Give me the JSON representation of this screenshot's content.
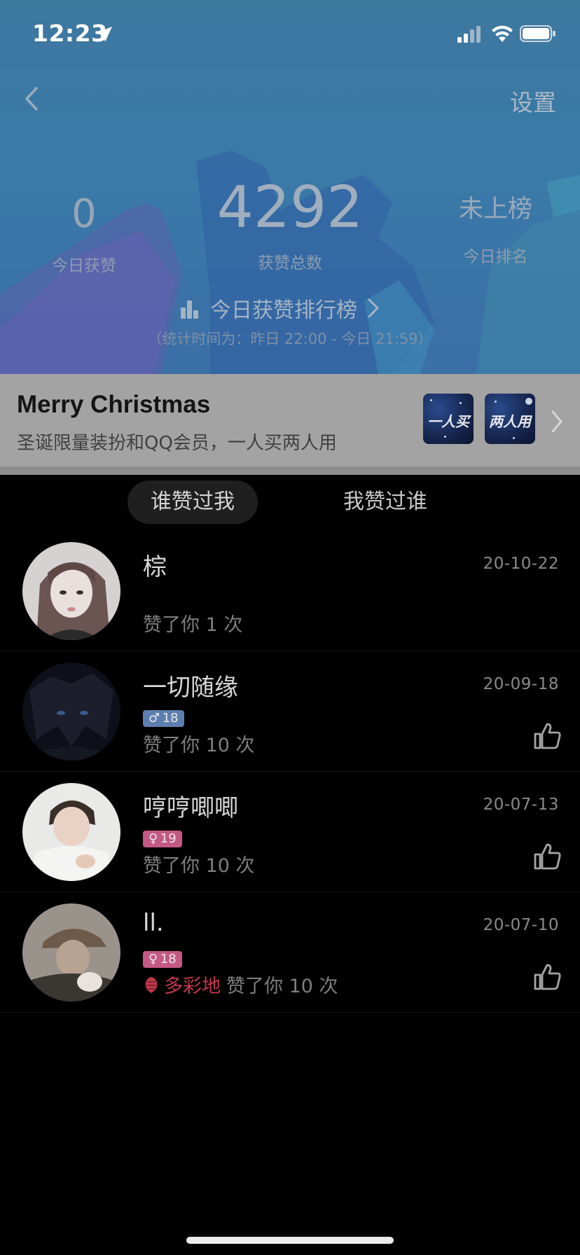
{
  "status": {
    "time": "12:23"
  },
  "header": {
    "settings_label": "设置",
    "stats": {
      "today_value": "0",
      "today_label": "今日获赞",
      "total_value": "4292",
      "total_label": "获赞总数",
      "rank_value": "未上榜",
      "rank_label": "今日排名"
    },
    "ranking_link_label": "今日获赞排行榜",
    "period_text": "（统计时间为：昨日 22:00 - 今日 21:59）"
  },
  "banner": {
    "title": "Merry Christmas",
    "subtitle": "圣诞限量装扮和QQ会员，一人买两人用",
    "thumb_1_label": "一人买",
    "thumb_2_label": "两人用"
  },
  "tabs": [
    {
      "label": "谁赞过我"
    },
    {
      "label": "我赞过谁"
    }
  ],
  "list": [
    {
      "name": "棕",
      "date": "20-10-22",
      "badge": "",
      "gender": "",
      "gift": "",
      "liked": "赞了你 1 次",
      "avatar_icon": "avatar-girl"
    },
    {
      "name": "一切随缘",
      "date": "20-09-18",
      "badge": "18",
      "gender": "male",
      "gift": "",
      "liked": "赞了你 10 次",
      "avatar_icon": "avatar-anime"
    },
    {
      "name": "哼哼唧唧",
      "date": "20-07-13",
      "badge": "19",
      "gender": "female",
      "gift": "",
      "liked": "赞了你 10 次",
      "avatar_icon": "avatar-boy"
    },
    {
      "name": "ll.",
      "date": "20-07-10",
      "badge": "18",
      "gender": "female",
      "gift": "多彩地",
      "liked": "赞了你 10 次",
      "avatar_icon": "avatar-cap"
    }
  ],
  "colors": {
    "header_bg": "#3a7aa8",
    "banner_bg": "#a3a3a3",
    "male_badge": "#5d7fb0",
    "female_badge": "#c45a83",
    "gift_red": "#c0394b"
  }
}
